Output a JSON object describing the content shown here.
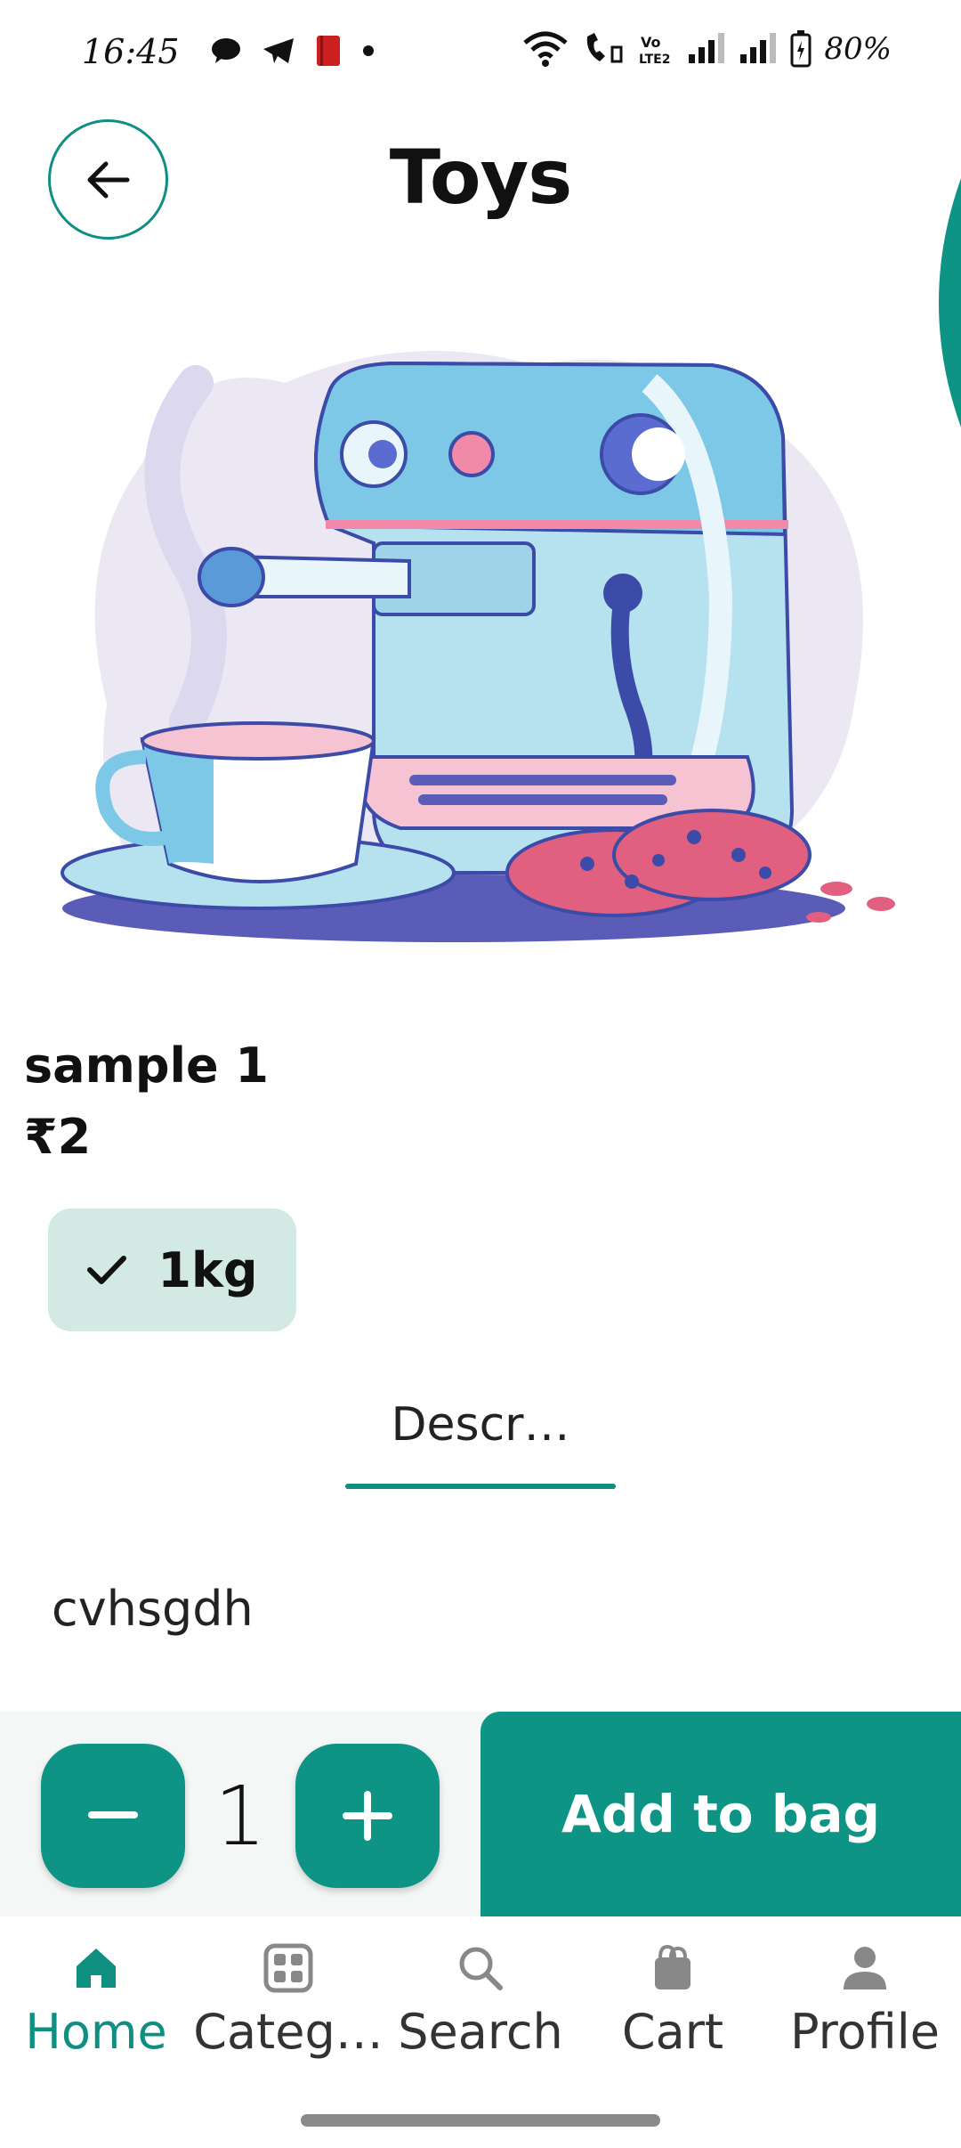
{
  "status_bar": {
    "time": "16:45",
    "battery": "80%",
    "icons": [
      "chat-bubble-icon",
      "telegram-icon",
      "book-icon",
      "dot-icon",
      "wifi-icon",
      "wifi-calling-icon",
      "volte-icon",
      "signal-icon",
      "signal-icon",
      "battery-icon"
    ]
  },
  "header": {
    "title": "Toys",
    "back_icon": "arrow-left-icon"
  },
  "product": {
    "image_icon": "coffee-machine-illustration",
    "name": "sample 1",
    "price": "₹2",
    "variant": {
      "label": "1kg",
      "selected": true,
      "icon": "check-icon"
    }
  },
  "tabs": {
    "items": [
      {
        "label": "Descr…",
        "active": true
      }
    ]
  },
  "description": {
    "text": "cvhsgdh"
  },
  "actions": {
    "quantity": "1",
    "minus_icon": "minus-icon",
    "plus_icon": "plus-icon",
    "add_to_bag_label": "Add to bag"
  },
  "bottom_nav": {
    "items": [
      {
        "label": "Home",
        "icon": "home-icon",
        "active": true
      },
      {
        "label": "Categ…",
        "icon": "grid-icon",
        "active": false
      },
      {
        "label": "Search",
        "icon": "search-icon",
        "active": false
      },
      {
        "label": "Cart",
        "icon": "shopping-bag-icon",
        "active": false
      },
      {
        "label": "Profile",
        "icon": "person-icon",
        "active": false
      }
    ]
  },
  "colors": {
    "accent": "#0e9485",
    "chip_background": "#d2e9e4",
    "action_bar_background": "#f4f7f6"
  }
}
